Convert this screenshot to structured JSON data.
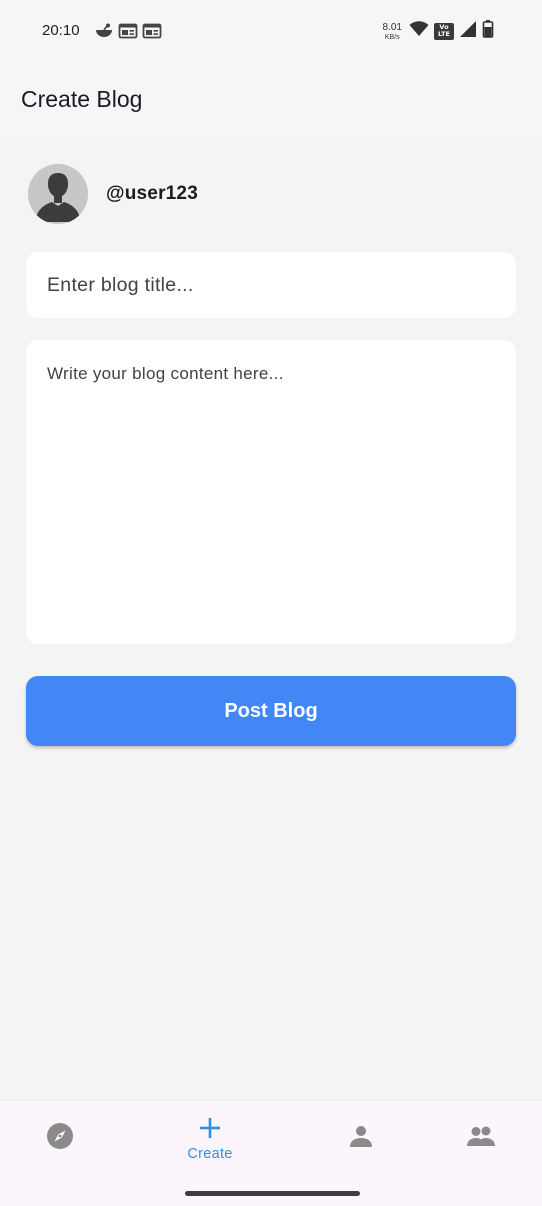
{
  "status_bar": {
    "time": "20:10",
    "net_speed_value": "8.01",
    "net_speed_unit": "KB/s",
    "volte_line1": "Vo",
    "volte_line2": "LTE",
    "left_icons": [
      "app-notification-icon",
      "news-icon",
      "news-icon"
    ],
    "right_icons": [
      "wifi-icon",
      "volte-icon",
      "signal-icon",
      "battery-icon"
    ]
  },
  "app_bar": {
    "title": "Create Blog"
  },
  "profile": {
    "username": "@user123",
    "avatar_icon": "default-avatar-icon"
  },
  "form": {
    "title_placeholder": "Enter blog title...",
    "title_value": "",
    "content_placeholder": "Write your blog content here...",
    "content_value": "",
    "submit_label": "Post Blog"
  },
  "bottom_nav": {
    "items": [
      {
        "icon": "compass-icon",
        "label": "",
        "selected": false
      },
      {
        "icon": "plus-icon",
        "label": "Create",
        "selected": true
      },
      {
        "icon": "person-icon",
        "label": "",
        "selected": false
      },
      {
        "icon": "people-icon",
        "label": "",
        "selected": false
      }
    ]
  },
  "colors": {
    "accent": "#4386f6",
    "nav_selected": "#2f8fe6",
    "nav_unselected": "#8a8a8a",
    "background": "#f4f4f5",
    "field_background": "#ffffff"
  }
}
